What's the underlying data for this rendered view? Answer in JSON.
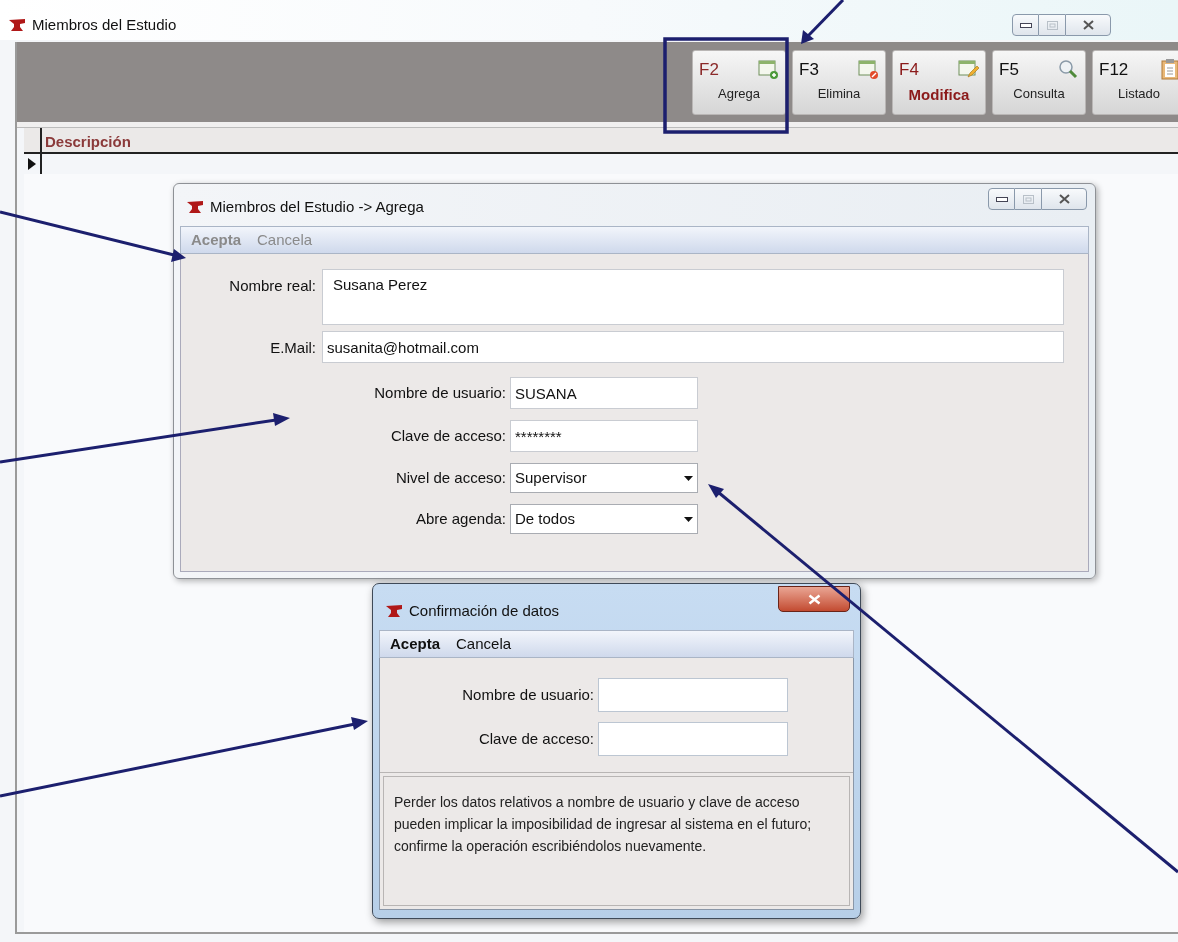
{
  "window": {
    "title": "Miembros del Estudio"
  },
  "toolbar": [
    {
      "key": "F2",
      "label": "Agrega",
      "kind": "add",
      "color": "#8b2a2a",
      "emphasized": false
    },
    {
      "key": "F3",
      "label": "Elimina",
      "kind": "delete",
      "color": "#111111",
      "emphasized": false
    },
    {
      "key": "F4",
      "label": "Modifica",
      "kind": "edit",
      "color": "#8b1a1a",
      "emphasized": true
    },
    {
      "key": "F5",
      "label": "Consulta",
      "kind": "search",
      "color": "#111111",
      "emphasized": false
    },
    {
      "key": "F12",
      "label": "Listado",
      "kind": "list",
      "color": "#111111",
      "emphasized": false
    }
  ],
  "table": {
    "columns": [
      "Descripción"
    ]
  },
  "add_dialog": {
    "title": "Miembros del Estudio -> Agrega",
    "menu": [
      {
        "label": "Acepta",
        "disabled": true
      },
      {
        "label": "Cancela",
        "disabled": true
      }
    ],
    "fields": [
      {
        "kind": "textarea",
        "label": "Nombre real:",
        "value": "Susana Perez"
      },
      {
        "kind": "text",
        "label": "E.Mail:",
        "value": "susanita@hotmail.com"
      },
      {
        "kind": "short",
        "label": "Nombre de usuario:",
        "value": "SUSANA"
      },
      {
        "kind": "short",
        "label": "Clave de acceso:",
        "value": "********"
      },
      {
        "kind": "dropdown",
        "label": "Nivel de acceso:",
        "value": "Supervisor"
      },
      {
        "kind": "dropdown",
        "label": "Abre agenda:",
        "value": "De todos"
      }
    ]
  },
  "confirm_dialog": {
    "title": "Confirmación de datos",
    "menu": [
      {
        "label": "Acepta",
        "disabled": false
      },
      {
        "label": "Cancela",
        "disabled": false
      }
    ],
    "fields": [
      {
        "label": "Nombre de usuario:"
      },
      {
        "label": "Clave de acceso:"
      }
    ],
    "message": "Perder los datos relativos a nombre de usuario y clave de  acceso pueden implicar la imposibilidad de ingresar al sistema en el futuro; confirme la operación escribiéndolos nuevamente."
  }
}
